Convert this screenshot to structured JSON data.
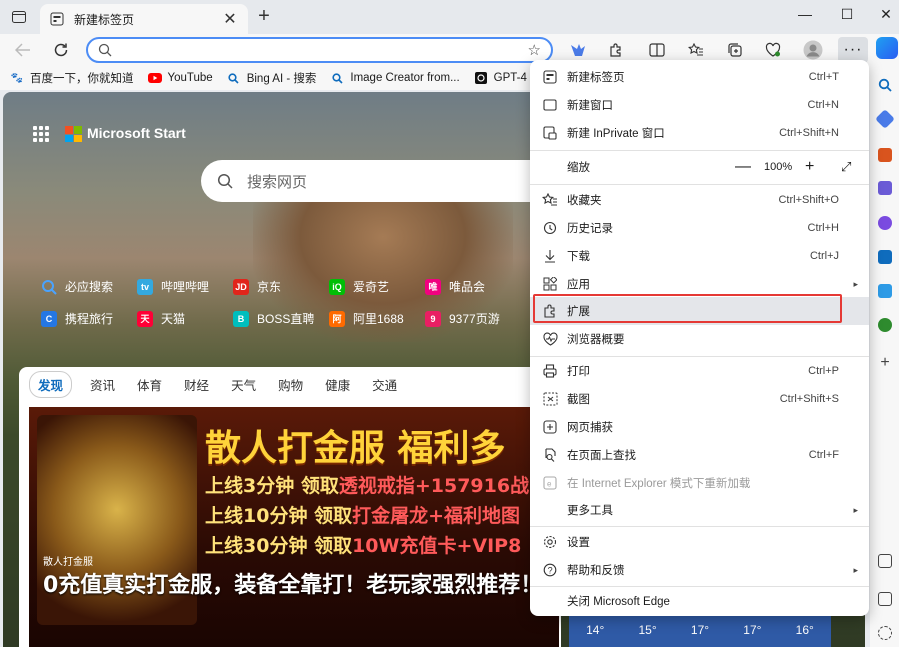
{
  "window": {
    "minimize": "—",
    "maximize": "☐",
    "close": "✕"
  },
  "tab": {
    "title": "新建标签页",
    "close": "✕"
  },
  "toolbar": {
    "address_value": "",
    "new_tab_symbol": "+",
    "more_symbol": "···"
  },
  "favorites": [
    {
      "label": "百度一下，你就知道",
      "icon": "paw-icon",
      "color": "#2932e1"
    },
    {
      "label": "YouTube",
      "icon": "youtube-icon",
      "color": "#ff0000"
    },
    {
      "label": "Bing AI - 搜索",
      "icon": "search-icon",
      "color": "#0f6cbd"
    },
    {
      "label": "Image Creator from...",
      "icon": "search-icon",
      "color": "#0f6cbd"
    },
    {
      "label": "GPT-4",
      "icon": "openai-icon",
      "color": "#111111"
    }
  ],
  "page": {
    "brand": "Microsoft Start",
    "search_placeholder": "搜索网页",
    "quick_links_row1": [
      {
        "label": "必应搜索",
        "color": "#1a73e8"
      },
      {
        "label": "哔哩哔哩",
        "color": "#fb7299"
      },
      {
        "label": "京东",
        "color": "#e1251b"
      },
      {
        "label": "爱奇艺",
        "color": "#00be06"
      },
      {
        "label": "唯品会",
        "color": "#f10180"
      }
    ],
    "quick_links_row2": [
      {
        "label": "携程旅行",
        "color": "#2577e3"
      },
      {
        "label": "天猫",
        "color": "#ff0036"
      },
      {
        "label": "BOSS直聘",
        "color": "#00bebd"
      },
      {
        "label": "阿里1688",
        "color": "#ff6a00"
      },
      {
        "label": "9377页游",
        "color": "#e91e63"
      }
    ],
    "feed_tabs": [
      "发现",
      "资讯",
      "体育",
      "财经",
      "天气",
      "购物",
      "健康",
      "交通"
    ],
    "hero": {
      "title_big": "散人打金服 福利多",
      "line1_a": "上线3分钟  领取",
      "line1_b": "透视戒指+157916战",
      "line2_a": "上线10分钟  领取",
      "line2_b": "打金屠龙+福利地图",
      "line3_a": "上线30分钟  领取",
      "line3_b": "10W充值卡+VIP8",
      "badge": "散人打金服",
      "headline": "0充值真实打金服，装备全靠打！老玩家强烈推荐！"
    },
    "weather_temps": [
      "14°",
      "15°",
      "17°",
      "17°",
      "16°"
    ]
  },
  "menu": {
    "items": [
      {
        "label": "新建标签页",
        "shortcut": "Ctrl+T",
        "icon": "new-tab-icon"
      },
      {
        "label": "新建窗口",
        "shortcut": "Ctrl+N",
        "icon": "new-window-icon"
      },
      {
        "label": "新建 InPrivate 窗口",
        "shortcut": "Ctrl+Shift+N",
        "icon": "inprivate-icon"
      },
      {
        "label": "缩放",
        "icon": "zoom"
      },
      {
        "label": "收藏夹",
        "shortcut": "Ctrl+Shift+O",
        "icon": "favorites-icon"
      },
      {
        "label": "历史记录",
        "shortcut": "Ctrl+H",
        "icon": "history-icon"
      },
      {
        "label": "下载",
        "shortcut": "Ctrl+J",
        "icon": "download-icon"
      },
      {
        "label": "应用",
        "icon": "apps-icon"
      },
      {
        "label": "扩展",
        "icon": "extensions-icon"
      },
      {
        "label": "浏览器概要",
        "icon": "browser-essentials-icon"
      },
      {
        "label": "打印",
        "shortcut": "Ctrl+P",
        "icon": "print-icon"
      },
      {
        "label": "截图",
        "shortcut": "Ctrl+Shift+S",
        "icon": "screenshot-icon"
      },
      {
        "label": "网页捕获",
        "icon": "web-capture-icon"
      },
      {
        "label": "在页面上查找",
        "shortcut": "Ctrl+F",
        "icon": "find-icon"
      },
      {
        "label": "在 Internet Explorer 模式下重新加载",
        "icon": "ie-mode-icon"
      },
      {
        "label": "更多工具",
        "icon": "more-tools"
      },
      {
        "label": "设置",
        "icon": "settings-icon"
      },
      {
        "label": "帮助和反馈",
        "icon": "help-icon"
      },
      {
        "label": "关闭 Microsoft Edge",
        "icon": "close-edge"
      }
    ],
    "zoom": {
      "minus": "—",
      "value": "100%",
      "plus": "+",
      "fullscreen": "⤢"
    },
    "submenu_arrow": "▸"
  },
  "colors": {
    "accent": "#0f6cbd",
    "highlight_border": "#e53935"
  }
}
